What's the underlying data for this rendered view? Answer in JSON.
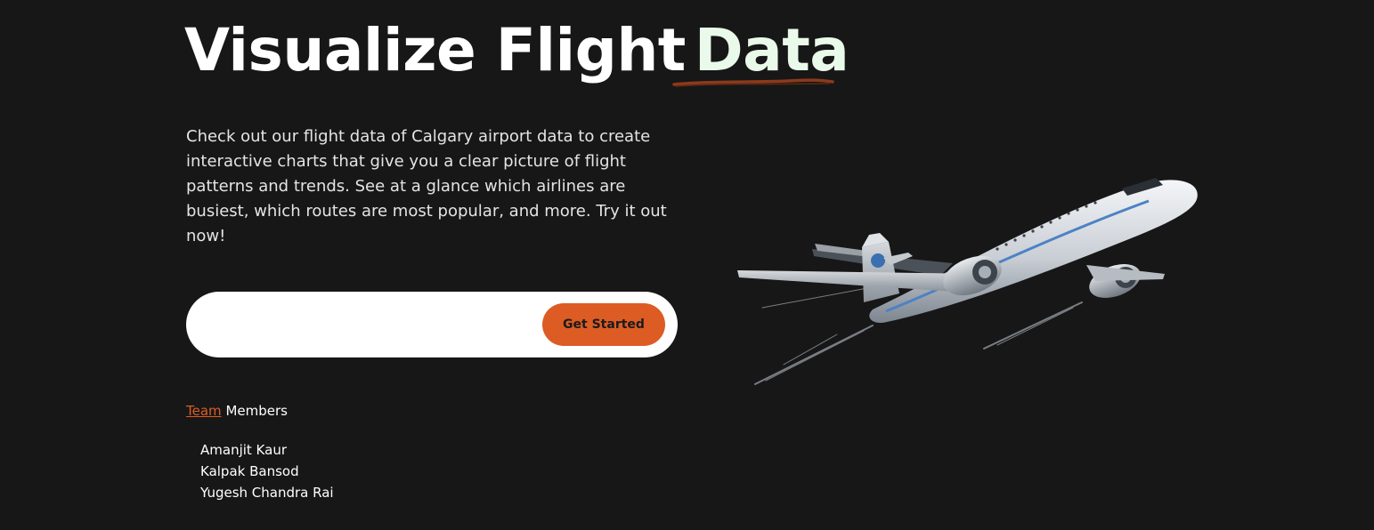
{
  "hero": {
    "title_main": "Visualize Flight",
    "title_accent": "Data",
    "description": "Check out our flight data of Calgary airport data to create interactive charts that give you a clear picture of flight patterns and trends. See at a glance which airlines are busiest, which routes are most popular, and more. Try it out now!"
  },
  "signup": {
    "input_value": "",
    "button_label": "Get Started"
  },
  "team": {
    "link_label": "Team",
    "heading_rest": "Members",
    "members": [
      "Amanjit Kaur",
      "Kalpak Bansod",
      "Yugesh Chandra Rai"
    ]
  },
  "icons": {
    "hero_image": "airplane-illustration",
    "title_decoration": "brush-underline"
  },
  "colors": {
    "background": "#171717",
    "accent": "#dc5c24",
    "accent_word": "#eafaea",
    "underline": "#8b3a1c",
    "text": "#ffffff"
  }
}
